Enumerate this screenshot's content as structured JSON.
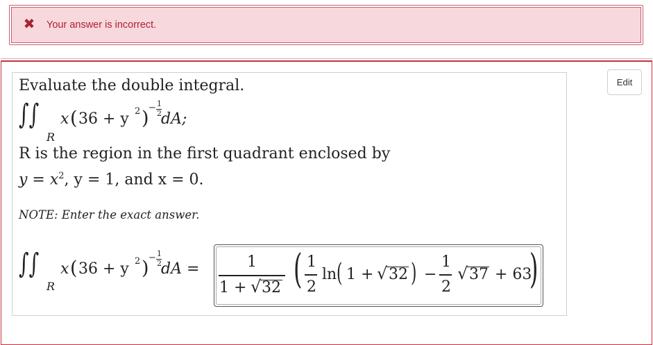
{
  "alert": {
    "icon": "close-icon",
    "message": "Your answer is incorrect."
  },
  "edit_button": {
    "label": "Edit"
  },
  "question": {
    "prompt": "Evaluate the double integral.",
    "integral": {
      "symbol": "∫∫",
      "region": "R",
      "integrand_left": "x",
      "open_paren": "(",
      "inner": "36 + y",
      "power2": "2",
      "close_paren": ")",
      "exponent": "−",
      "exp_num": "1",
      "exp_den": "2",
      "differential": "dA;",
      "differential_answer": "dA ="
    },
    "region_text": "R is the region in the first quadrant enclosed by",
    "curves": {
      "eq1": "y = x",
      "eq1_pow": "2",
      "rest": ", y = 1, and x = 0."
    },
    "note": "NOTE: Enter the exact answer."
  },
  "answer": {
    "frac_num": "1",
    "frac_den_prefix": "1 + ",
    "frac_den_sqrt": "32",
    "half_num": "1",
    "half_den": "2",
    "ln": "ln",
    "ln_inner_prefix": "1 + ",
    "ln_inner_sqrt": "32",
    "minus": "−",
    "half2_num": "1",
    "half2_den": "2",
    "sqrt37": "37",
    "plus63": "+ 63"
  }
}
